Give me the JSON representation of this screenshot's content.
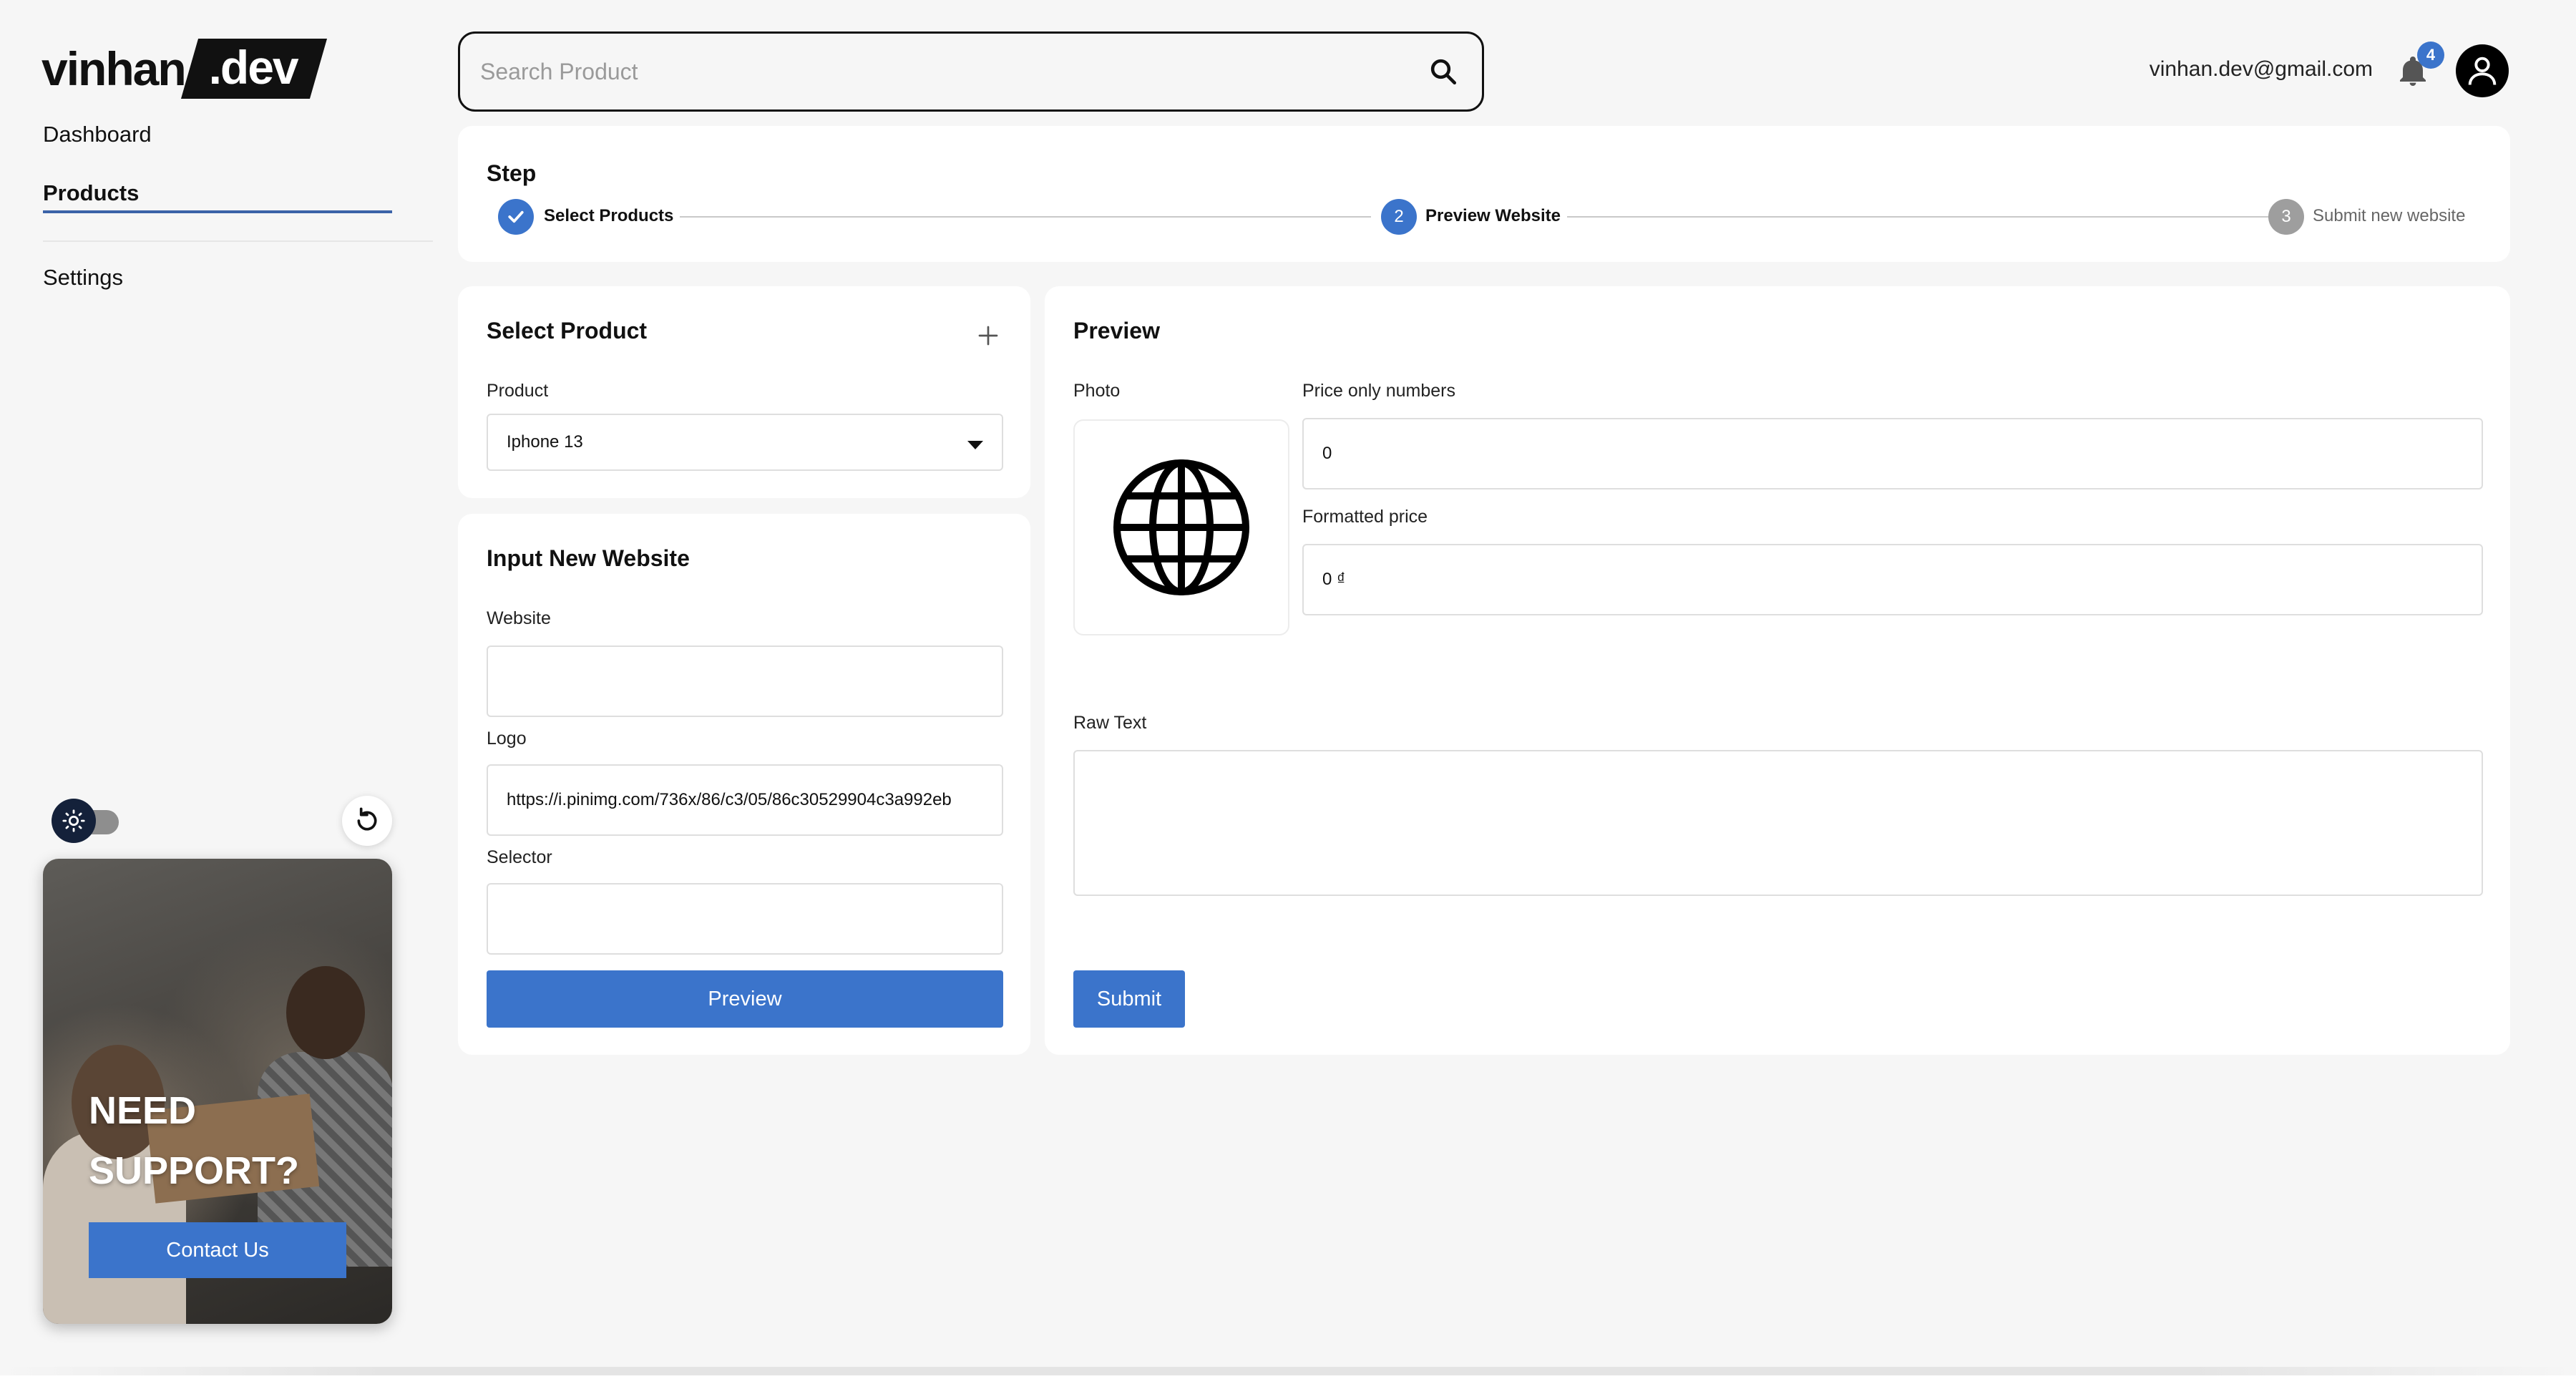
{
  "brand": {
    "name": "vinhan",
    "suffix": ".dev"
  },
  "sidebar": {
    "items": [
      {
        "label": "Dashboard",
        "active": false
      },
      {
        "label": "Products",
        "active": true
      },
      {
        "label": "Settings",
        "active": false
      }
    ],
    "theme_toggle": {
      "icon": "sun-icon",
      "state": "light"
    },
    "reset_icon": "refresh-icon",
    "support": {
      "title_line1": "NEED",
      "title_line2": "SUPPORT?",
      "button_label": "Contact Us"
    }
  },
  "header": {
    "search": {
      "placeholder": "Search Product",
      "value": ""
    },
    "user_email": "vinhan.dev@gmail.com",
    "notifications": {
      "count": "4"
    }
  },
  "stepper": {
    "title": "Step",
    "steps": [
      {
        "number": "1",
        "label": "Select Products",
        "state": "done"
      },
      {
        "number": "2",
        "label": "Preview Website",
        "state": "active"
      },
      {
        "number": "3",
        "label": "Submit new website",
        "state": "pending"
      }
    ]
  },
  "select_product": {
    "title": "Select Product",
    "product_label": "Product",
    "product_value": "Iphone 13"
  },
  "input_website": {
    "title": "Input New Website",
    "website_label": "Website",
    "website_value": "",
    "logo_label": "Logo",
    "logo_value": "https://i.pinimg.com/736x/86/c3/05/86c30529904c3a992eb",
    "selector_label": "Selector",
    "selector_value": "",
    "preview_button": "Preview"
  },
  "preview": {
    "title": "Preview",
    "photo_label": "Photo",
    "photo_icon": "globe-icon",
    "price_label": "Price only numbers",
    "price_value": "0",
    "formatted_label": "Formatted price",
    "formatted_value": "0 ₫",
    "raw_text_label": "Raw Text",
    "raw_text_value": "",
    "submit_button": "Submit"
  },
  "colors": {
    "accent": "#3b74cb",
    "done_step": "#3b74cb",
    "pending_step": "#9e9e9e",
    "background": "#f6f6f6"
  }
}
